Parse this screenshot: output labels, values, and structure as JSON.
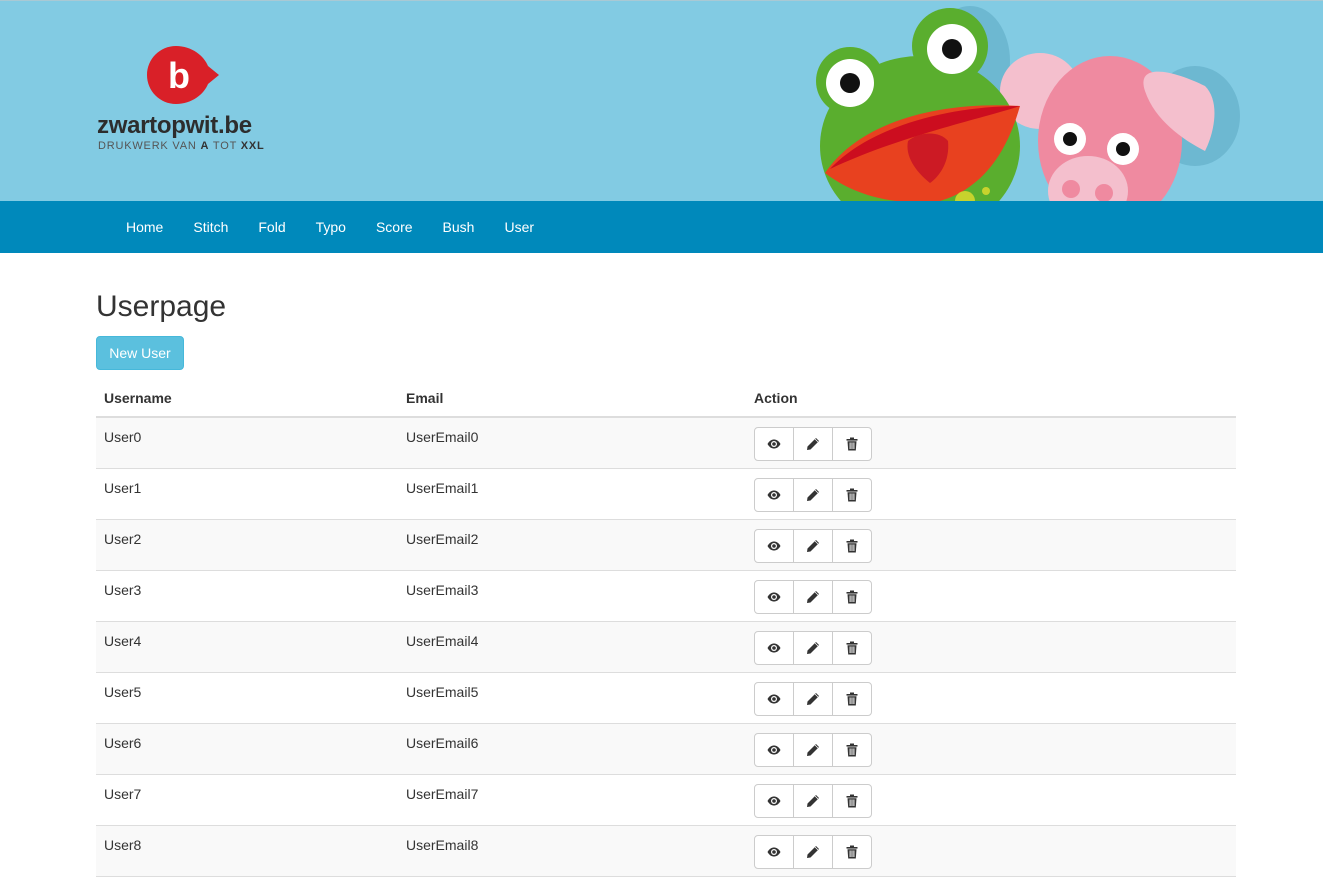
{
  "brand": {
    "name": "zwartopwit.be",
    "tagline_prefix": "DRUKWERK VAN",
    "tagline_a": "A",
    "tagline_mid": "TOT",
    "tagline_end": "XXL",
    "logo_letter": "b",
    "logo_color": "#d92028"
  },
  "nav": {
    "items": [
      {
        "label": "Home"
      },
      {
        "label": "Stitch"
      },
      {
        "label": "Fold"
      },
      {
        "label": "Typo"
      },
      {
        "label": "Score"
      },
      {
        "label": "Bush"
      },
      {
        "label": "User"
      }
    ],
    "background": "#0089bb"
  },
  "page": {
    "title": "Userpage",
    "new_user_label": "New User",
    "accent": "#5bc0de"
  },
  "table": {
    "columns": [
      "Username",
      "Email",
      "Action"
    ],
    "rows": [
      {
        "username": "User0",
        "email": "UserEmail0"
      },
      {
        "username": "User1",
        "email": "UserEmail1"
      },
      {
        "username": "User2",
        "email": "UserEmail2"
      },
      {
        "username": "User3",
        "email": "UserEmail3"
      },
      {
        "username": "User4",
        "email": "UserEmail4"
      },
      {
        "username": "User5",
        "email": "UserEmail5"
      },
      {
        "username": "User6",
        "email": "UserEmail6"
      },
      {
        "username": "User7",
        "email": "UserEmail7"
      },
      {
        "username": "User8",
        "email": "UserEmail8"
      }
    ],
    "row_actions": [
      {
        "icon": "eye-icon",
        "action": "view"
      },
      {
        "icon": "pencil-icon",
        "action": "edit"
      },
      {
        "icon": "trash-icon",
        "action": "delete"
      }
    ]
  }
}
